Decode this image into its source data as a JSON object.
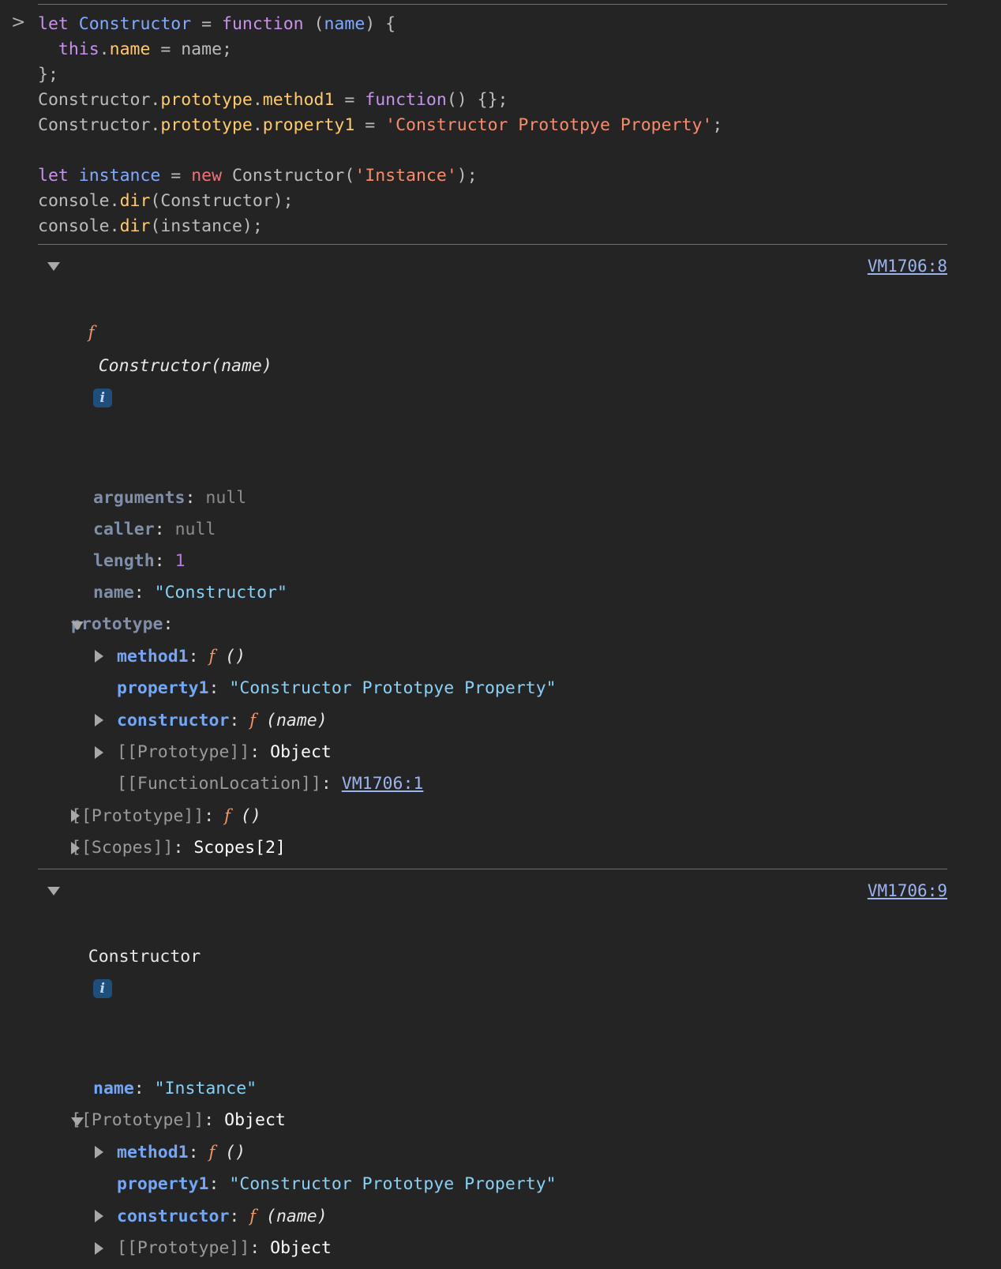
{
  "console": {
    "prompt_chevron": ">",
    "input_lines": [
      [
        {
          "t": "let",
          "c": "kw"
        },
        {
          "t": " ",
          "c": "plain"
        },
        {
          "t": "Constructor",
          "c": "ident"
        },
        {
          "t": " = ",
          "c": "plain"
        },
        {
          "t": "function",
          "c": "kw"
        },
        {
          "t": " (",
          "c": "plain"
        },
        {
          "t": "name",
          "c": "ident"
        },
        {
          "t": ") {",
          "c": "plain"
        }
      ],
      [
        {
          "t": "  ",
          "c": "plain"
        },
        {
          "t": "this",
          "c": "kw"
        },
        {
          "t": ".",
          "c": "plain"
        },
        {
          "t": "name",
          "c": "prop"
        },
        {
          "t": " = name;",
          "c": "plain"
        }
      ],
      [
        {
          "t": "};",
          "c": "plain"
        }
      ],
      [
        {
          "t": "Constructor.",
          "c": "plain"
        },
        {
          "t": "prototype",
          "c": "prop"
        },
        {
          "t": ".",
          "c": "plain"
        },
        {
          "t": "method1",
          "c": "prop"
        },
        {
          "t": " = ",
          "c": "plain"
        },
        {
          "t": "function",
          "c": "kw"
        },
        {
          "t": "() {};",
          "c": "plain"
        }
      ],
      [
        {
          "t": "Constructor.",
          "c": "plain"
        },
        {
          "t": "prototype",
          "c": "prop"
        },
        {
          "t": ".",
          "c": "plain"
        },
        {
          "t": "property1",
          "c": "prop"
        },
        {
          "t": " = ",
          "c": "plain"
        },
        {
          "t": "'Constructor Prototpye Property'",
          "c": "str"
        },
        {
          "t": ";",
          "c": "plain"
        }
      ],
      [
        {
          "t": "",
          "c": "plain"
        }
      ],
      [
        {
          "t": "let",
          "c": "kw"
        },
        {
          "t": " ",
          "c": "plain"
        },
        {
          "t": "instance",
          "c": "ident"
        },
        {
          "t": " = ",
          "c": "plain"
        },
        {
          "t": "new",
          "c": "kw-new"
        },
        {
          "t": " Constructor(",
          "c": "plain"
        },
        {
          "t": "'Instance'",
          "c": "str"
        },
        {
          "t": ");",
          "c": "plain"
        }
      ],
      [
        {
          "t": "console.",
          "c": "plain"
        },
        {
          "t": "dir",
          "c": "prop"
        },
        {
          "t": "(Constructor);",
          "c": "plain"
        }
      ],
      [
        {
          "t": "console.",
          "c": "plain"
        },
        {
          "t": "dir",
          "c": "prop"
        },
        {
          "t": "(instance);",
          "c": "plain"
        }
      ]
    ],
    "group1": {
      "source_link": "VM1706:8",
      "header": {
        "fn_glyph": "f",
        "signature": "Constructor(name)",
        "info_badge": "i"
      },
      "rows": [
        {
          "indent": "i1",
          "name": "arguments",
          "name_style": "pname",
          "sep": ": ",
          "value": "null",
          "value_style": "v-null"
        },
        {
          "indent": "i1",
          "name": "caller",
          "name_style": "pname",
          "sep": ": ",
          "value": "null",
          "value_style": "v-null"
        },
        {
          "indent": "i1",
          "name": "length",
          "name_style": "pname",
          "sep": ": ",
          "value": "1",
          "value_style": "v-num"
        },
        {
          "indent": "i1",
          "name": "name",
          "name_style": "pname",
          "sep": ": ",
          "value": "\"Constructor\"",
          "value_style": "v-str"
        },
        {
          "indent": "i2",
          "tri": "open",
          "tri_level": "l1",
          "name": "prototype",
          "name_style": "pname",
          "sep": ":",
          "value": "",
          "value_style": "v-obj"
        },
        {
          "indent": "i3",
          "tri": "closed",
          "tri_level": "l2",
          "name": "method1",
          "name_style": "pname-bright",
          "sep": ": ",
          "fn": true,
          "fn_glyph": "f",
          "fn_sig": "()"
        },
        {
          "indent": "i3",
          "name": "property1",
          "name_style": "pname-bright",
          "sep": ": ",
          "value": "\"Constructor Prototpye Property\"",
          "value_style": "v-str"
        },
        {
          "indent": "i3",
          "tri": "closed",
          "tri_level": "l2",
          "name": "constructor",
          "name_style": "pname-bright",
          "sep": ": ",
          "fn": true,
          "fn_glyph": "f",
          "fn_sig": "(name)"
        },
        {
          "indent": "i3",
          "tri": "closed",
          "tri_level": "l2",
          "name": "[[Prototype]]",
          "name_style": "internal",
          "sep": ": ",
          "value": "Object",
          "value_style": "v-obj"
        },
        {
          "indent": "i3",
          "name": "[[FunctionLocation]]",
          "name_style": "internal",
          "sep": ": ",
          "link": "VM1706:1"
        },
        {
          "indent": "i2",
          "tri": "closed",
          "tri_level": "l1",
          "name": "[[Prototype]]",
          "name_style": "internal",
          "sep": ": ",
          "fn": true,
          "fn_glyph": "f",
          "fn_sig": "()"
        },
        {
          "indent": "i2",
          "tri": "closed",
          "tri_level": "l1",
          "name": "[[Scopes]]",
          "name_style": "internal",
          "sep": ": ",
          "value": "Scopes[2]",
          "value_style": "v-obj"
        }
      ]
    },
    "group2": {
      "source_link": "VM1706:9",
      "header": {
        "signature": "Constructor",
        "info_badge": "i"
      },
      "rows": [
        {
          "indent": "i1",
          "name": "name",
          "name_style": "pname-bright",
          "sep": ": ",
          "value": "\"Instance\"",
          "value_style": "v-str"
        },
        {
          "indent": "i2",
          "tri": "open",
          "tri_level": "l1",
          "name": "[[Prototype]]",
          "name_style": "internal",
          "sep": ": ",
          "value": "Object",
          "value_style": "v-obj"
        },
        {
          "indent": "i3",
          "tri": "closed",
          "tri_level": "l2",
          "name": "method1",
          "name_style": "pname-bright",
          "sep": ": ",
          "fn": true,
          "fn_glyph": "f",
          "fn_sig": "()"
        },
        {
          "indent": "i3",
          "name": "property1",
          "name_style": "pname-bright",
          "sep": ": ",
          "value": "\"Constructor Prototpye Property\"",
          "value_style": "v-str"
        },
        {
          "indent": "i3",
          "tri": "closed",
          "tri_level": "l2",
          "name": "constructor",
          "name_style": "pname-bright",
          "sep": ": ",
          "fn": true,
          "fn_glyph": "f",
          "fn_sig": "(name)"
        },
        {
          "indent": "i3",
          "tri": "closed",
          "tri_level": "l2",
          "name": "[[Prototype]]",
          "name_style": "internal",
          "sep": ": ",
          "value": "Object",
          "value_style": "v-obj"
        }
      ]
    }
  },
  "colors": {
    "background": "#242424",
    "divider": "#6e6e6e",
    "keyword": "#c792ea",
    "new_keyword": "#f07178",
    "identifier": "#82aaff",
    "property": "#ffcb6b",
    "string_literal": "#f78c6c",
    "default_text": "#bcbcbc",
    "prop_name": "#7f8fa8",
    "prop_name_nested": "#73a6f5",
    "internal_prop": "#9a9a9a",
    "value_null": "#8c8c8c",
    "value_number": "#b17fe0",
    "value_string": "#86d1f5",
    "value_object": "#ffffff",
    "link": "#9cb4ee",
    "fn_glyph": "#f29668",
    "badge_bg": "#1e4e79"
  }
}
